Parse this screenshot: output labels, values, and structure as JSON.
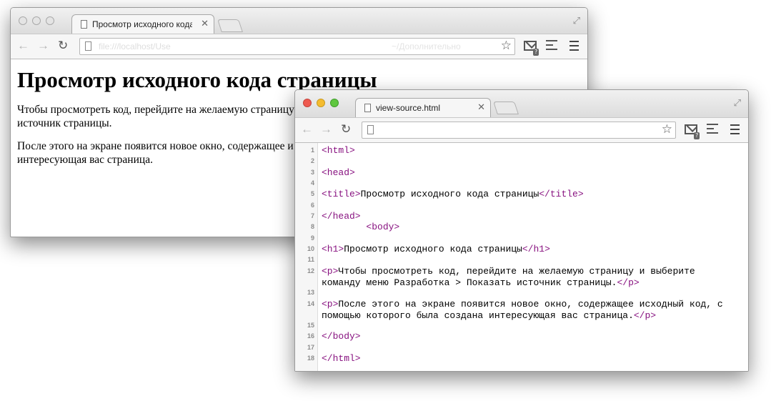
{
  "window1": {
    "tab_title": "Просмотр исходного кода",
    "url_left": "file:///localhost/Use",
    "url_right": "~/Дополнительно",
    "badge": "?",
    "page": {
      "heading": "Просмотр исходного кода страницы",
      "p1_line1": "Чтобы просмотреть код, перейдите на желаемую страницу",
      "p1_line2": "источник страницы.",
      "p2_line1": "После этого на экране появится новое окно, содержащее и",
      "p2_line2": "интересующая вас страница."
    }
  },
  "window2": {
    "tab_title": "view-source.html",
    "badge": "?",
    "lines": [
      {
        "n": "1",
        "segments": [
          {
            "t": "<html>",
            "tag": true
          }
        ]
      },
      {
        "n": "2",
        "segments": []
      },
      {
        "n": "3",
        "segments": [
          {
            "t": "<head>",
            "tag": true
          }
        ]
      },
      {
        "n": "4",
        "segments": []
      },
      {
        "n": "5",
        "segments": [
          {
            "t": "<title>",
            "tag": true
          },
          {
            "t": "Просмотр исходного кода страницы",
            "tag": false
          },
          {
            "t": "</title>",
            "tag": true
          }
        ]
      },
      {
        "n": "6",
        "segments": []
      },
      {
        "n": "7",
        "segments": [
          {
            "t": "</head>",
            "tag": true
          }
        ]
      },
      {
        "n": "8",
        "segments": [
          {
            "t": "        ",
            "tag": false
          },
          {
            "t": "<body>",
            "tag": true
          }
        ]
      },
      {
        "n": "9",
        "segments": []
      },
      {
        "n": "10",
        "segments": [
          {
            "t": "<h1>",
            "tag": true
          },
          {
            "t": "Просмотр исходного кода страницы",
            "tag": false
          },
          {
            "t": "</h1>",
            "tag": true
          }
        ]
      },
      {
        "n": "11",
        "segments": []
      },
      {
        "n": "12",
        "segments": [
          {
            "t": "<p>",
            "tag": true
          },
          {
            "t": "Чтобы просмотреть код, перейдите на желаемую страницу и выберите\nкоманду меню Разработка > Показать источник страницы.",
            "tag": false
          },
          {
            "t": "</p>",
            "tag": true
          }
        ]
      },
      {
        "n": "13",
        "segments": []
      },
      {
        "n": "14",
        "segments": [
          {
            "t": "<p>",
            "tag": true
          },
          {
            "t": "После этого на экране появится новое окно, содержащее исходный код, с\nпомощью которого была создана интересующая вас страница.",
            "tag": false
          },
          {
            "t": "</p>",
            "tag": true
          }
        ]
      },
      {
        "n": "15",
        "segments": []
      },
      {
        "n": "16",
        "segments": [
          {
            "t": "</body>",
            "tag": true
          }
        ]
      },
      {
        "n": "17",
        "segments": []
      },
      {
        "n": "18",
        "segments": [
          {
            "t": "</html>",
            "tag": true
          }
        ]
      }
    ]
  }
}
